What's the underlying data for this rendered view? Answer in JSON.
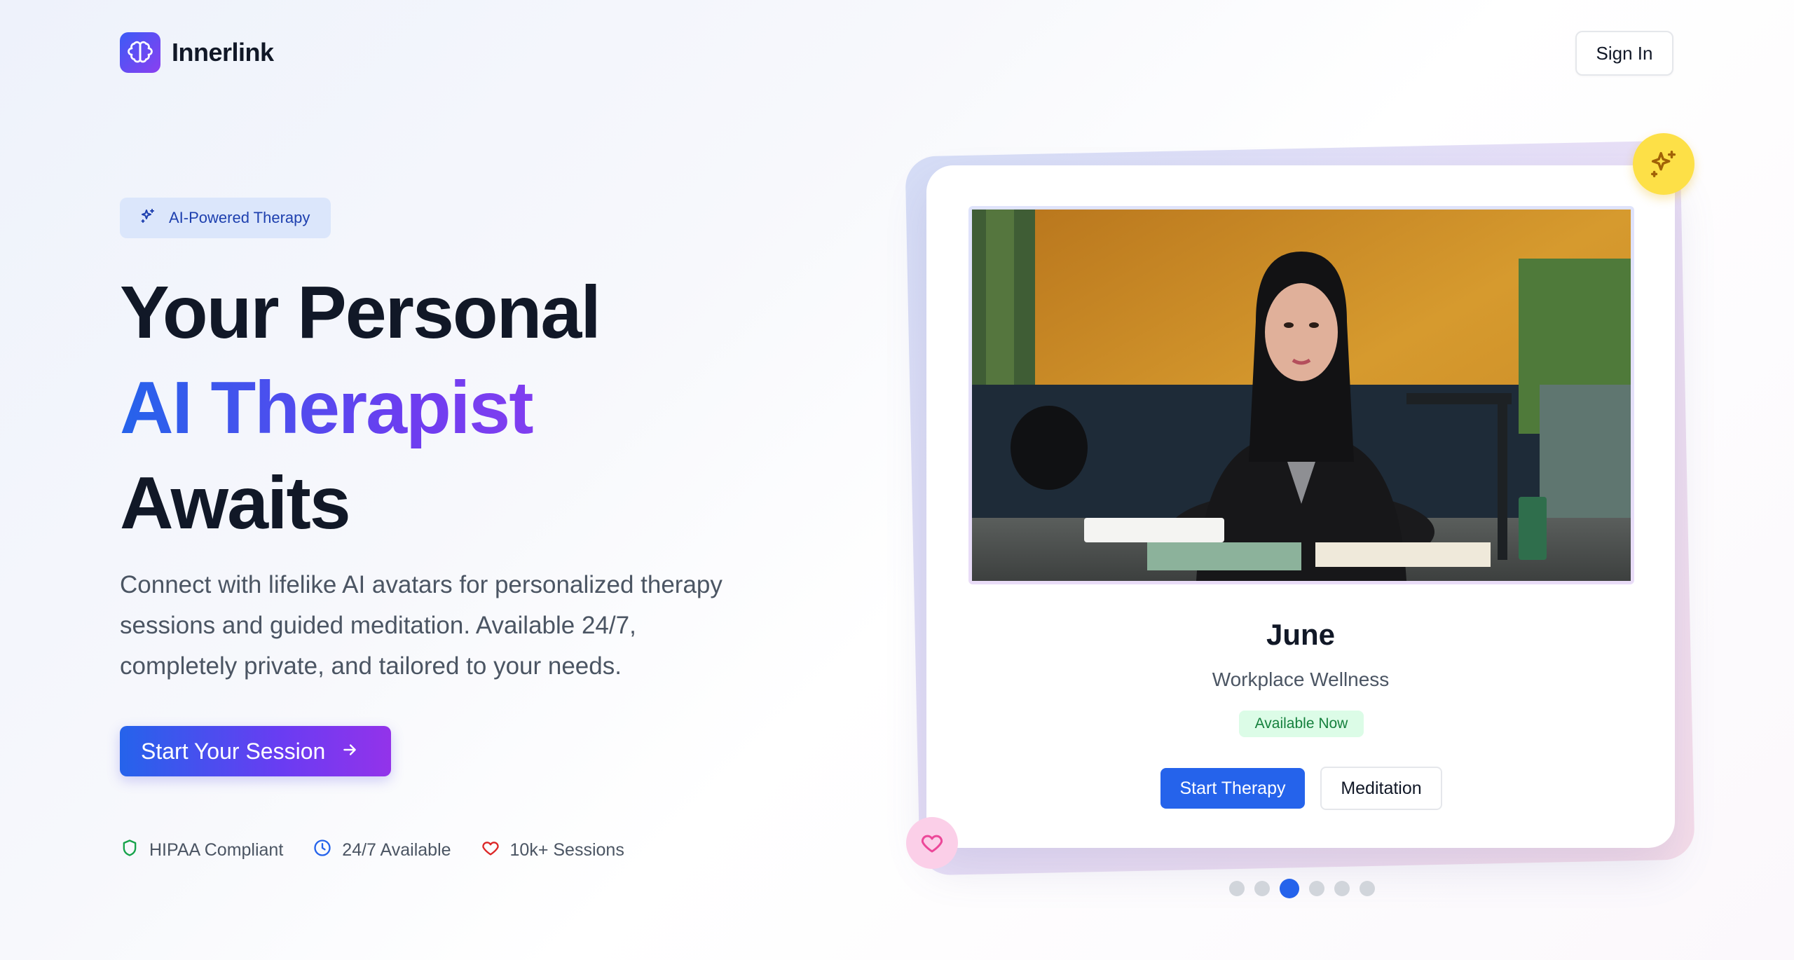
{
  "header": {
    "brand": "Innerlink",
    "sign_in": "Sign In"
  },
  "hero": {
    "badge": "AI-Powered Therapy",
    "headline_line1": "Your Personal",
    "headline_line2": "AI Therapist",
    "headline_line3": "Awaits",
    "description": "Connect with lifelike AI avatars for personalized therapy sessions and guided meditation. Available 24/7, completely private, and tailored to your needs.",
    "cta": "Start Your Session",
    "features": [
      {
        "label": "HIPAA Compliant",
        "icon": "shield-icon",
        "color": "#16a34a"
      },
      {
        "label": "24/7 Available",
        "icon": "clock-icon",
        "color": "#2563eb"
      },
      {
        "label": "10k+ Sessions",
        "icon": "heart-icon",
        "color": "#dc2626"
      }
    ]
  },
  "therapist_card": {
    "name": "June",
    "specialty": "Workplace Wellness",
    "status": "Available Now",
    "primary_action": "Start Therapy",
    "secondary_action": "Meditation"
  },
  "carousel": {
    "total": 6,
    "active_index": 2
  },
  "colors": {
    "accent": "#2563eb",
    "gradient_end": "#9333ea",
    "status_green": "#15803d"
  }
}
